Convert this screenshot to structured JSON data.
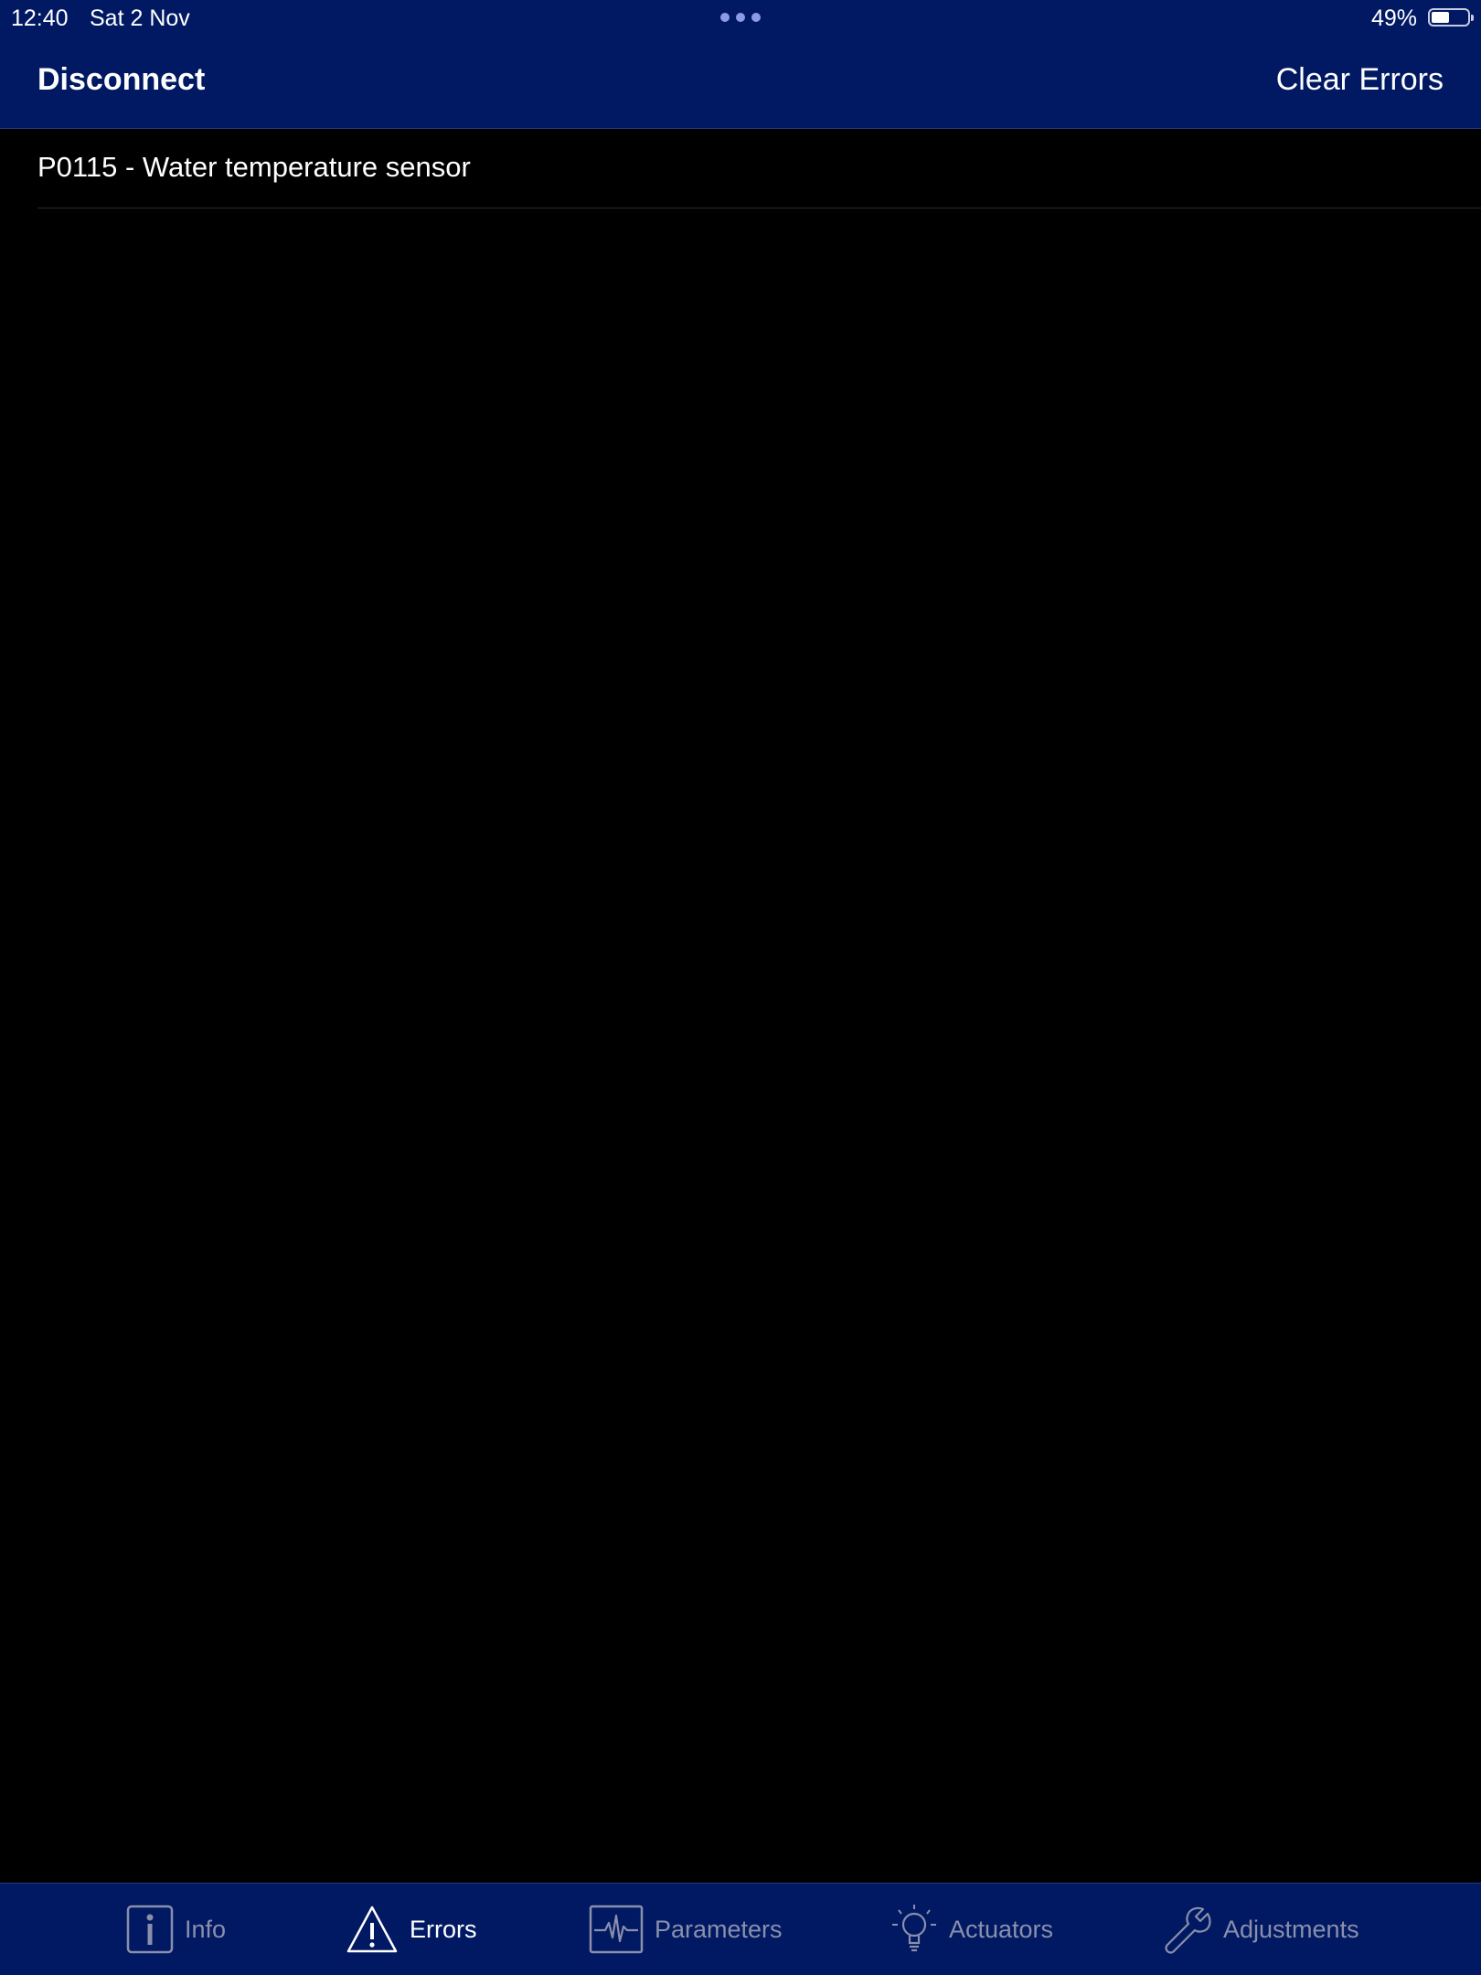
{
  "status_bar": {
    "time": "12:40",
    "date": "Sat 2 Nov",
    "battery_percent": "49%",
    "battery_level": 0.49
  },
  "nav": {
    "left_button": "Disconnect",
    "right_button": "Clear Errors"
  },
  "errors": [
    {
      "label": "P0115 - Water temperature sensor"
    }
  ],
  "tabs": [
    {
      "label": "Info",
      "icon": "info-icon",
      "active": false
    },
    {
      "label": "Errors",
      "icon": "warning-triangle-icon",
      "active": true
    },
    {
      "label": "Parameters",
      "icon": "waveform-icon",
      "active": false
    },
    {
      "label": "Actuators",
      "icon": "lightbulb-icon",
      "active": false
    },
    {
      "label": "Adjustments",
      "icon": "wrench-icon",
      "active": false
    }
  ],
  "colors": {
    "bar_background": "#011963",
    "content_background": "#000000",
    "active_tab": "#ffffff",
    "inactive_tab": "#8a8fab"
  }
}
